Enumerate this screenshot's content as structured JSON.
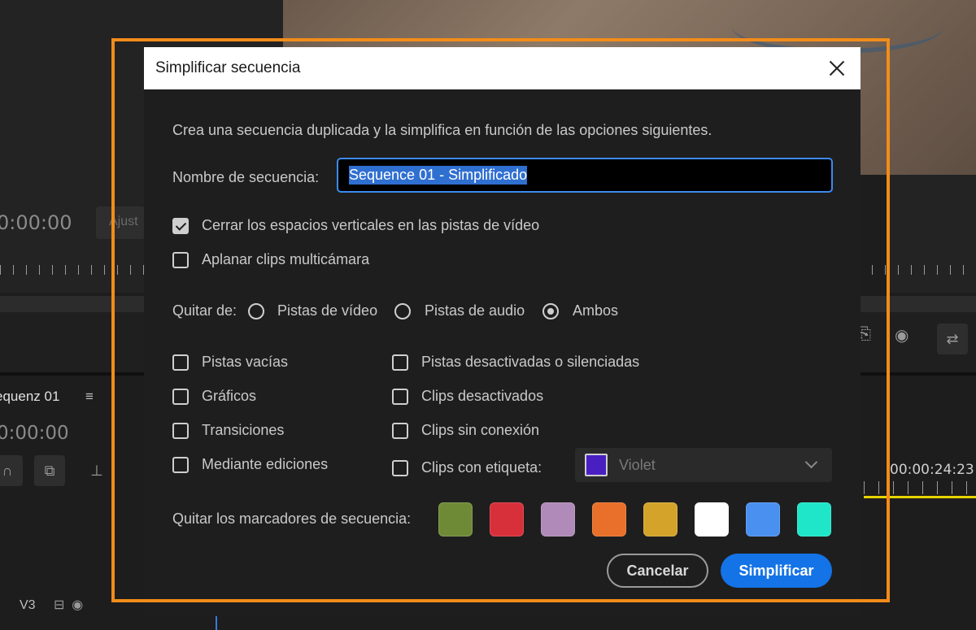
{
  "background": {
    "monitor_timecode": "0:00:00",
    "monitor_button": "Ajust",
    "sequence_tab": "equenz 01",
    "sequence_timecode": "0:00:00",
    "right_timecode": "00:00:24:23",
    "track_label": "V3"
  },
  "dialog": {
    "title": "Simplificar secuencia",
    "description": "Crea una secuencia duplicada y la simplifica en función de las opciones siguientes.",
    "name_label": "Nombre de secuencia:",
    "name_value": "Sequence 01 - Simplificado",
    "option_close_gaps": {
      "label": "Cerrar los espacios verticales en las pistas de vídeo",
      "checked": true
    },
    "option_flatten_multicam": {
      "label": "Aplanar clips multicámara",
      "checked": false
    },
    "remove_from": {
      "label": "Quitar de:",
      "options": [
        "Pistas de vídeo",
        "Pistas de audio",
        "Ambos"
      ],
      "selected": "Ambos"
    },
    "left_checks": [
      "Pistas vacías",
      "Gráficos",
      "Transiciones",
      "Mediante ediciones"
    ],
    "right_checks": [
      "Pistas desactivadas o silenciadas",
      "Clips desactivados",
      "Clips sin conexión",
      "Clips con etiqueta:"
    ],
    "label_select": {
      "value": "Violet",
      "color": "#4a1fc2"
    },
    "markers_label": "Quitar los marcadores de secuencia:",
    "marker_colors": [
      "#6f8a36",
      "#d8303a",
      "#b08ab8",
      "#e8702a",
      "#d4a42a",
      "#ffffff",
      "#4a90f0",
      "#1fe6c8"
    ],
    "cancel_label": "Cancelar",
    "ok_label": "Simplificar"
  },
  "colors": {
    "highlight": "#f28c1a",
    "accent": "#1473e6"
  }
}
